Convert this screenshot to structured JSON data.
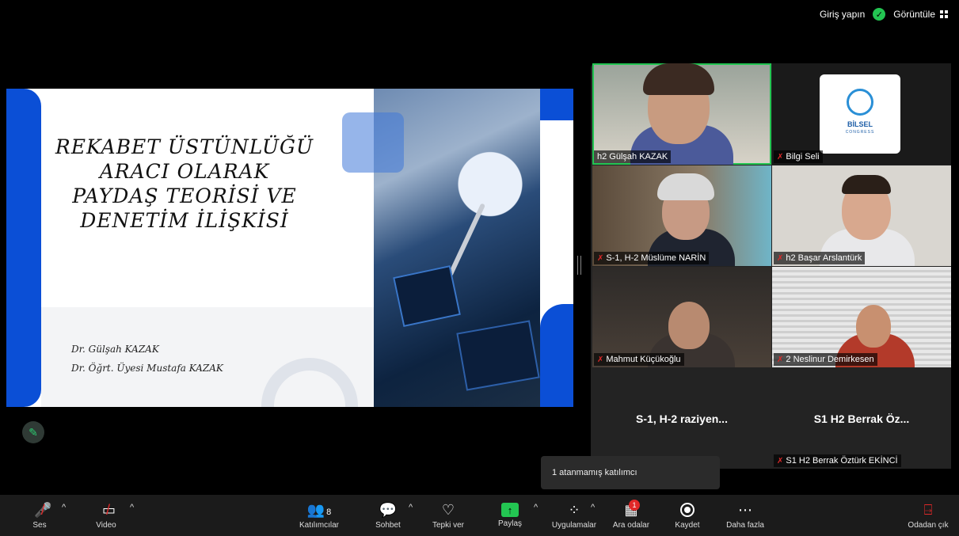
{
  "topbar": {
    "signin": "Giriş yapın",
    "view": "Görüntüle"
  },
  "slide": {
    "title_lines": [
      "REKABET ÜSTÜNLÜĞÜ",
      "ARACI OLARAK",
      "PAYDAŞ TEORİSİ VE",
      "DENETİM İLİŞKİSİ"
    ],
    "authors": [
      "Dr. Gülşah KAZAK",
      "Dr. Öğrt. Üyesi Mustafa KAZAK"
    ]
  },
  "gallery": {
    "tiles": [
      {
        "name": "h2 Gülşah KAZAK",
        "muted": false
      },
      {
        "name": "Bilgi Seli",
        "muted": true,
        "logo_text": "BİLSEL",
        "logo_sub": "CONGRESS"
      },
      {
        "name": "S-1, H-2 Müslüme NARİN",
        "muted": true
      },
      {
        "name": "h2 Başar Arslantürk",
        "muted": true
      },
      {
        "name": "Mahmut Küçükoğlu",
        "muted": true
      },
      {
        "name": "2 Neslinur Demirkesen",
        "muted": true
      }
    ],
    "text_tiles": [
      {
        "big": "S-1, H-2 raziyen..."
      },
      {
        "big": "S1 H2 Berrak Öz...",
        "name": "S1 H2 Berrak Öztürk EKİNCİ"
      }
    ]
  },
  "tooltip": "1 atanmamış katılımcı",
  "toolbar": {
    "audio": "Ses",
    "video": "Video",
    "participants": "Katılımcılar",
    "participants_count": "8",
    "chat": "Sohbet",
    "react": "Tepki ver",
    "share": "Paylaş",
    "apps": "Uygulamalar",
    "breakout": "Ara odalar",
    "breakout_badge": "1",
    "record": "Kaydet",
    "more": "Daha fazla",
    "leave": "Odadan çık"
  },
  "colors": {
    "accent_green": "#23c552",
    "slide_blue": "#0b4fd6",
    "danger": "#e02828"
  }
}
